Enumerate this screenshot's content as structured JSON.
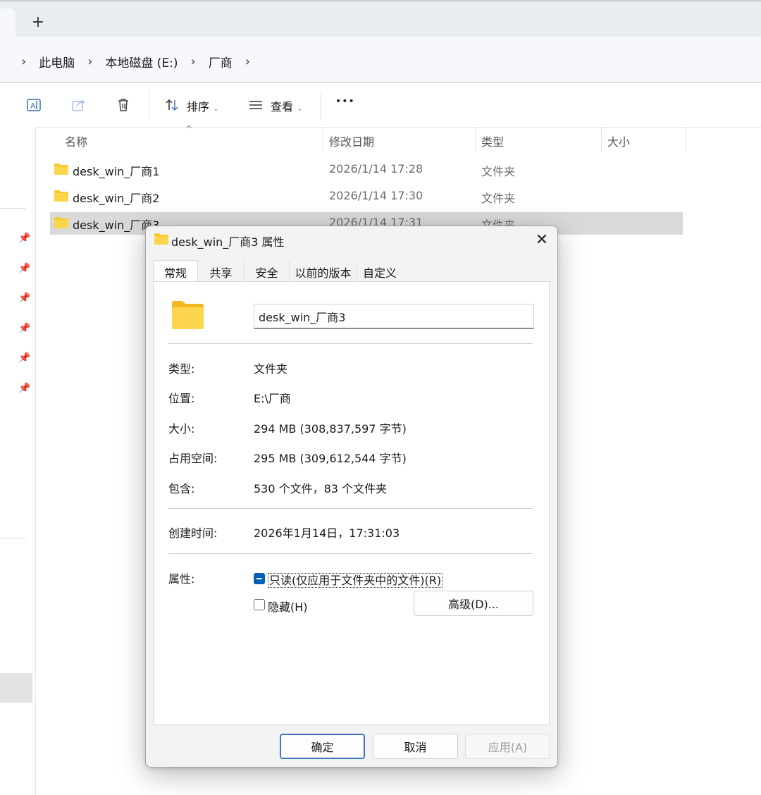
{
  "tab_strip": {
    "new_tab_glyph": "+"
  },
  "breadcrumb": {
    "separator": "›",
    "items": [
      "此电脑",
      "本地磁盘 (E:)",
      "厂商"
    ]
  },
  "toolbar": {
    "sort_label": "排序",
    "view_label": "查看",
    "more_glyph": "•••",
    "icons": [
      "rename-icon",
      "share-icon",
      "delete-icon",
      "sort-icon",
      "view-icon"
    ]
  },
  "file_list": {
    "columns": {
      "name": "名称",
      "date": "修改日期",
      "type": "类型",
      "size": "大小"
    },
    "rows": [
      {
        "name": "desk_win_厂商1",
        "date": "2026/1/14 17:28",
        "type": "文件夹",
        "selected": false
      },
      {
        "name": "desk_win_厂商2",
        "date": "2026/1/14 17:30",
        "type": "文件夹",
        "selected": false
      },
      {
        "name": "desk_win_厂商3",
        "date": "2026/1/14 17:31",
        "type": "文件夹",
        "selected": true
      }
    ]
  },
  "dialog": {
    "title": "desk_win_厂商3 属性",
    "close_glyph": "✕",
    "tabs": [
      "常规",
      "共享",
      "安全",
      "以前的版本",
      "自定义"
    ],
    "active_tab": "常规",
    "name_value": "desk_win_厂商3",
    "props": {
      "type_label": "类型:",
      "type_value": "文件夹",
      "location_label": "位置:",
      "location_value": "E:\\厂商",
      "size_label": "大小:",
      "size_value": "294 MB (308,837,597 字节)",
      "disk_label": "占用空间:",
      "disk_value": "295 MB (309,612,544 字节)",
      "contains_label": "包含:",
      "contains_value": "530 个文件，83 个文件夹",
      "created_label": "创建时间:",
      "created_value": "2026年1月14日，17:31:03",
      "attributes_label": "属性:"
    },
    "attributes": {
      "readonly_label": "只读(仅应用于文件夹中的文件)(R)",
      "readonly_state": "indeterminate",
      "hidden_label": "隐藏(H)",
      "hidden_state": "unchecked",
      "advanced_label": "高级(D)..."
    },
    "buttons": {
      "ok": "确定",
      "cancel": "取消",
      "apply": "应用(A)"
    }
  },
  "colors": {
    "folder_yellow": "#f8c92e",
    "accent": "#005fb8",
    "selection": "#d9d9d9"
  }
}
